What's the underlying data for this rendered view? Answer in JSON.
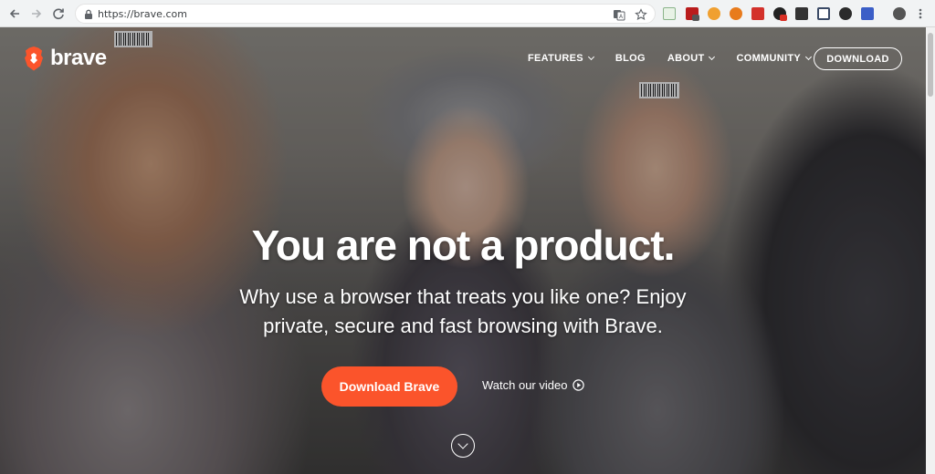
{
  "browser": {
    "url": "https://brave.com",
    "extensions": [
      "translate-icon",
      "star-icon"
    ]
  },
  "site": {
    "logo_text": "brave",
    "nav": {
      "features": "FEATURES",
      "blog": "BLOG",
      "about": "ABOUT",
      "community": "COMMUNITY",
      "download": "DOWNLOAD"
    },
    "hero": {
      "headline": "You are not a product.",
      "sub_line1": "Why use a browser that treats you like one? Enjoy",
      "sub_line2": "private, secure and fast browsing with Brave.",
      "cta": "Download Brave",
      "video": "Watch our video"
    }
  },
  "colors": {
    "brand": "#fb542b",
    "chrome": "#f1f3f4"
  }
}
